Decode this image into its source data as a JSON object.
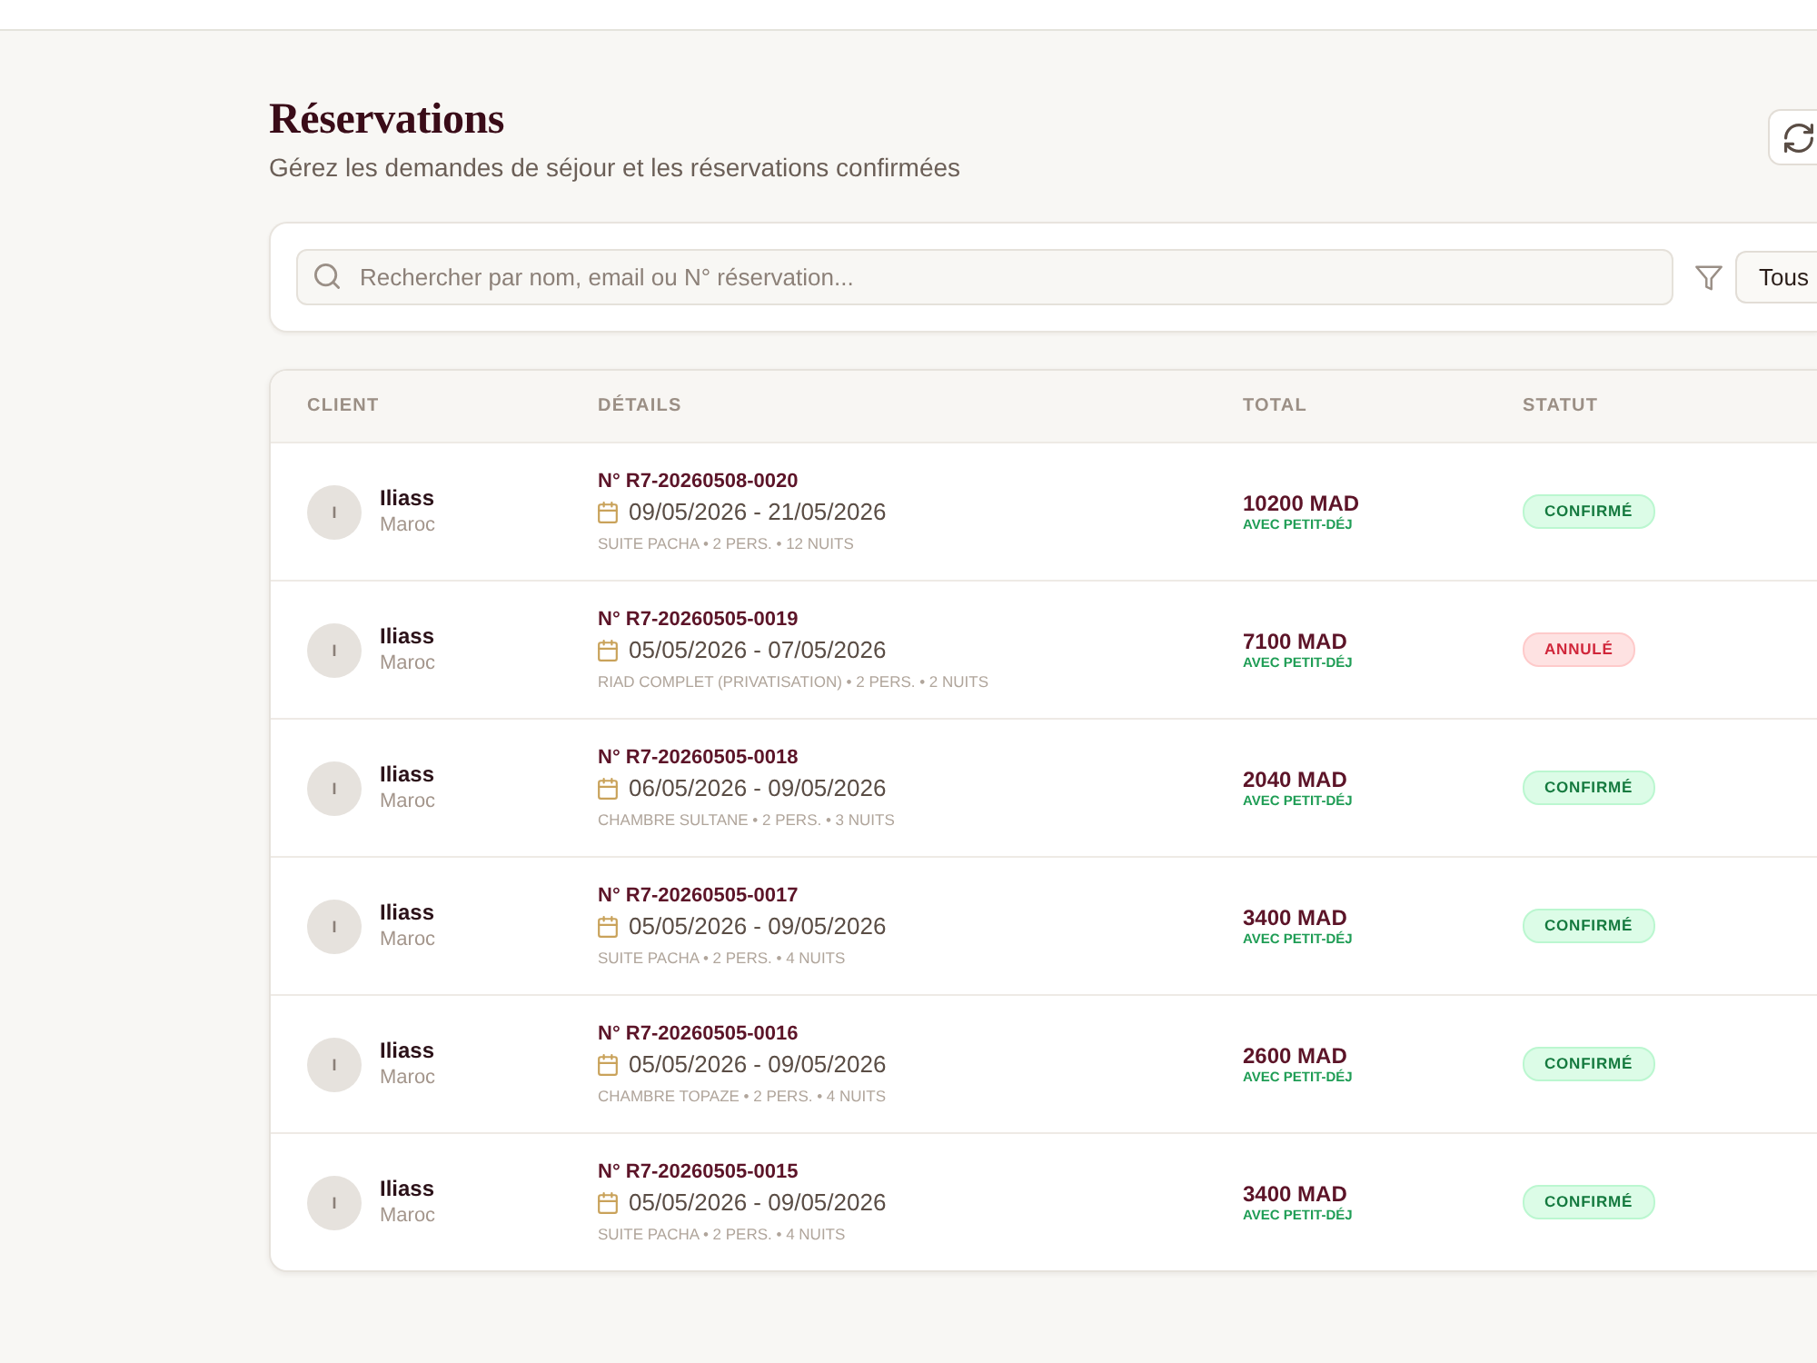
{
  "header": {
    "title": "Réservations",
    "subtitle": "Gérez les demandes de séjour et les réservations confirmées"
  },
  "filters": {
    "search": {
      "placeholder": "Rechercher par nom, email ou N° réservation..."
    },
    "status_filter": {
      "value": "Tous"
    }
  },
  "table": {
    "columns": [
      "CLIENT",
      "DÉTAILS",
      "TOTAL",
      "STATUT"
    ],
    "rows": [
      {
        "client": {
          "initial": "I",
          "name": "Iliass",
          "country": "Maroc"
        },
        "reference": "N° R7-20260508-0020",
        "dates": "09/05/2026 - 21/05/2026",
        "summary": "SUITE PACHA • 2 PERS. • 12 NUITS",
        "total": "10200 MAD",
        "total_note": "AVEC PETIT-DÉJ",
        "status": {
          "label": "CONFIRMÉ",
          "kind": "confirmed"
        }
      },
      {
        "client": {
          "initial": "I",
          "name": "Iliass",
          "country": "Maroc"
        },
        "reference": "N° R7-20260505-0019",
        "dates": "05/05/2026 - 07/05/2026",
        "summary": "RIAD COMPLET (PRIVATISATION) • 2 PERS. • 2 NUITS",
        "total": "7100 MAD",
        "total_note": "AVEC PETIT-DÉJ",
        "status": {
          "label": "ANNULÉ",
          "kind": "cancelled"
        }
      },
      {
        "client": {
          "initial": "I",
          "name": "Iliass",
          "country": "Maroc"
        },
        "reference": "N° R7-20260505-0018",
        "dates": "06/05/2026 - 09/05/2026",
        "summary": "CHAMBRE SULTANE • 2 PERS. • 3 NUITS",
        "total": "2040 MAD",
        "total_note": "AVEC PETIT-DÉJ",
        "status": {
          "label": "CONFIRMÉ",
          "kind": "confirmed"
        }
      },
      {
        "client": {
          "initial": "I",
          "name": "Iliass",
          "country": "Maroc"
        },
        "reference": "N° R7-20260505-0017",
        "dates": "05/05/2026 - 09/05/2026",
        "summary": "SUITE PACHA • 2 PERS. • 4 NUITS",
        "total": "3400 MAD",
        "total_note": "AVEC PETIT-DÉJ",
        "status": {
          "label": "CONFIRMÉ",
          "kind": "confirmed"
        }
      },
      {
        "client": {
          "initial": "I",
          "name": "Iliass",
          "country": "Maroc"
        },
        "reference": "N° R7-20260505-0016",
        "dates": "05/05/2026 - 09/05/2026",
        "summary": "CHAMBRE TOPAZE • 2 PERS. • 4 NUITS",
        "total": "2600 MAD",
        "total_note": "AVEC PETIT-DÉJ",
        "status": {
          "label": "CONFIRMÉ",
          "kind": "confirmed"
        }
      },
      {
        "client": {
          "initial": "I",
          "name": "Iliass",
          "country": "Maroc"
        },
        "reference": "N° R7-20260505-0015",
        "dates": "05/05/2026 - 09/05/2026",
        "summary": "SUITE PACHA • 2 PERS. • 4 NUITS",
        "total": "3400 MAD",
        "total_note": "AVEC PETIT-DÉJ",
        "status": {
          "label": "CONFIRMÉ",
          "kind": "confirmed"
        }
      }
    ]
  }
}
